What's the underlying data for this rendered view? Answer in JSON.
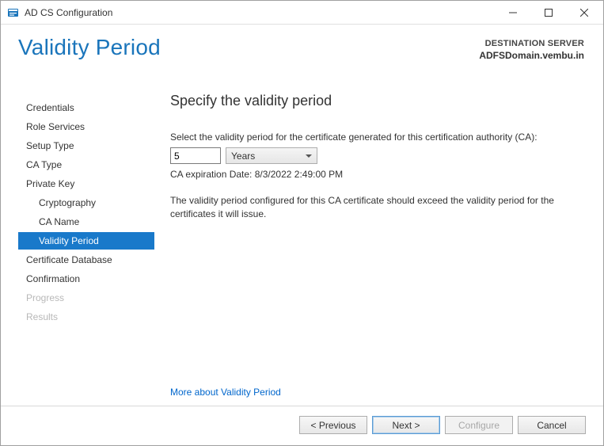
{
  "window": {
    "title": "AD CS Configuration"
  },
  "page_title": "Validity Period",
  "destination": {
    "label": "DESTINATION SERVER",
    "value": "ADFSDomain.vembu.in"
  },
  "nav": {
    "items": [
      {
        "label": "Credentials"
      },
      {
        "label": "Role Services"
      },
      {
        "label": "Setup Type"
      },
      {
        "label": "CA Type"
      },
      {
        "label": "Private Key"
      },
      {
        "label": "Cryptography"
      },
      {
        "label": "CA Name"
      },
      {
        "label": "Validity Period"
      },
      {
        "label": "Certificate Database"
      },
      {
        "label": "Confirmation"
      },
      {
        "label": "Progress"
      },
      {
        "label": "Results"
      }
    ]
  },
  "content": {
    "heading": "Specify the validity period",
    "instruction": "Select the validity period for the certificate generated for this certification authority (CA):",
    "period_value": "5",
    "period_unit": "Years",
    "expiration_line": "CA expiration Date: 8/3/2022 2:49:00 PM",
    "info_paragraph": "The validity period configured for this CA certificate should exceed the validity period for the certificates it will issue.",
    "more_link": "More about Validity Period"
  },
  "footer": {
    "previous": "< Previous",
    "next": "Next >",
    "configure": "Configure",
    "cancel": "Cancel"
  }
}
